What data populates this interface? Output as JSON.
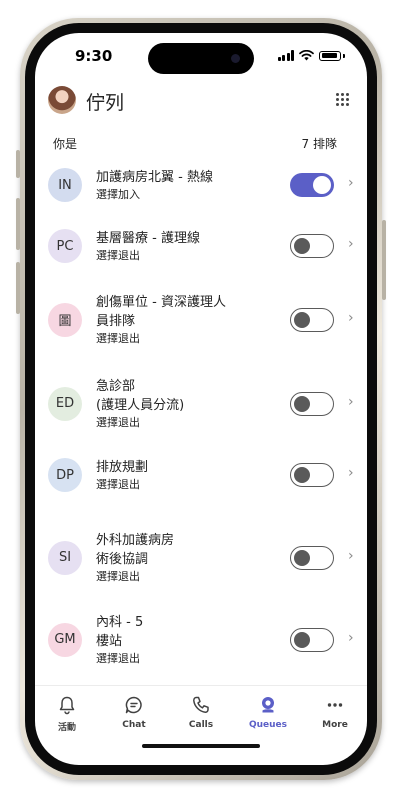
{
  "status_bar": {
    "time": "9:30"
  },
  "header": {
    "title": "佇列"
  },
  "summary": {
    "you_label": "你是",
    "queue_count": "7 排隊"
  },
  "queues": [
    {
      "initials": "IN",
      "avatar_color": "#d3dcef",
      "name": "加護病房北翼 - 熱線",
      "status": "選擇加入",
      "toggle": "on"
    },
    {
      "initials": "PC",
      "avatar_color": "#e6e0f2",
      "name": "基層醫療 - 護理線",
      "status": "選擇退出",
      "toggle": "off"
    },
    {
      "initials": "圖",
      "avatar_color": "#f7d7e2",
      "name": "創傷單位 - 資深護理人\n員排隊",
      "status": "選擇退出",
      "toggle": "off"
    },
    {
      "initials": "ED",
      "avatar_color": "#e3ede0",
      "name": "急診部\n (護理人員分流)",
      "status": "選擇退出",
      "toggle": "off"
    },
    {
      "initials": "DP",
      "avatar_color": "#d7e2f2",
      "name": "排放規劃",
      "status": "選擇退出",
      "toggle": "off"
    },
    {
      "initials": "SI",
      "avatar_color": "#e6e0f2",
      "name": "外科加護病房\n術後協調",
      "status": "選擇退出",
      "toggle": "off"
    },
    {
      "initials": "GM",
      "avatar_color": "#f7d7e2",
      "name": "內科 - 5\n樓站",
      "status": "選擇退出",
      "toggle": "off"
    }
  ],
  "tabs": [
    {
      "label": "活動",
      "icon": "bell-icon"
    },
    {
      "label": "Chat",
      "icon": "chat-icon"
    },
    {
      "label": "Calls",
      "icon": "phone-icon"
    },
    {
      "label": "Queues",
      "icon": "queues-icon",
      "active": true
    },
    {
      "label": "More",
      "icon": "more-icon"
    }
  ],
  "colors": {
    "accent": "#5b5fc7",
    "toggle_off": "#5a5a5a"
  }
}
